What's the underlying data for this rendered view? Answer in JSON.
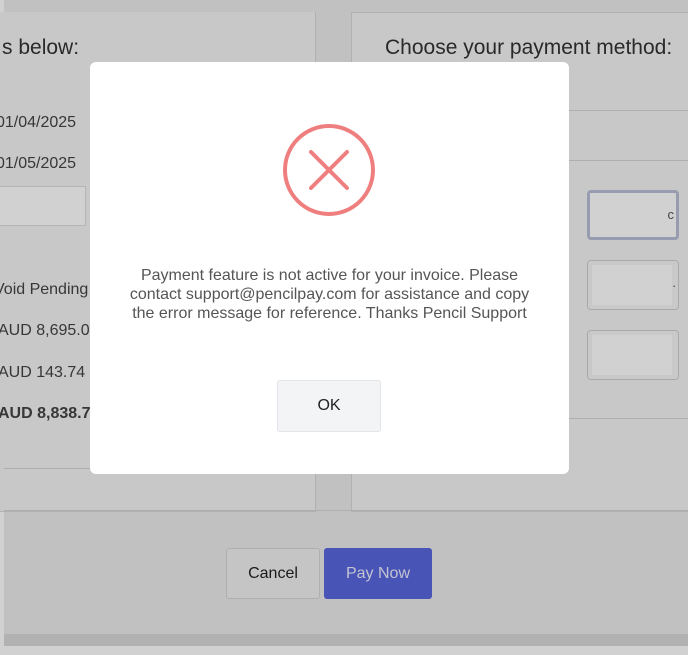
{
  "invoice_panel": {
    "heading": "s below:",
    "date_1": "01/04/2025",
    "date_2": "01/05/2025",
    "status": "Void Pending",
    "amount_1": "AUD 8,695.0",
    "amount_2": "AUD 143.74",
    "total": "AUD 8,838.7"
  },
  "payment_panel": {
    "heading": "Choose your payment method:",
    "card_1_trail": "c",
    "card_2_trail": "."
  },
  "footer_buttons": {
    "cancel_label": "Cancel",
    "pay_now_label": "Pay Now"
  },
  "dialog": {
    "icon": "error-x-circle-icon",
    "message": "Payment feature is not active for your invoice. Please contact support@pencilpay.com for assistance and copy the error message for reference. Thanks Pencil Support",
    "ok_label": "OK"
  },
  "colors": {
    "error_red": "#ef7f7f",
    "primary_blue": "#5a67e0",
    "overlay": "rgba(0,0,0,0.18)"
  }
}
